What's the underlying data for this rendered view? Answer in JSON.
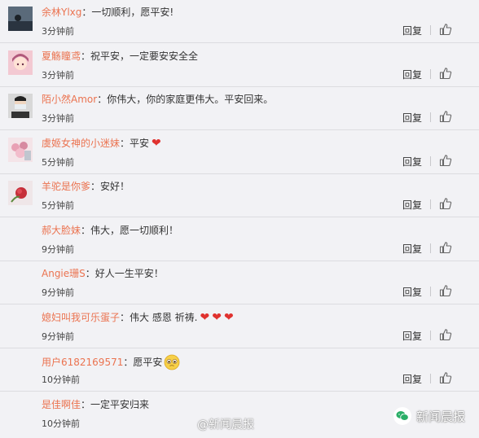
{
  "comments": [
    {
      "username": "余林Ylxg",
      "separator": "：",
      "text": "一切顺利，愿平安!",
      "time": "3分钟前",
      "reply": "回复",
      "avatar": "avatar-photo-dark"
    },
    {
      "username": "夏觞瞳鸢",
      "separator": "：",
      "text": "祝平安，一定要安安全全",
      "time": "3分钟前",
      "reply": "回复",
      "avatar": "avatar-anime-girl"
    },
    {
      "username": "陌小然Amor",
      "separator": "：",
      "text": "你伟大，你的家庭更伟大。平安回来。",
      "time": "3分钟前",
      "reply": "回复",
      "avatar": "avatar-masked-face"
    },
    {
      "username": "虞姬女神的小迷妹",
      "separator": "：",
      "text": "平安",
      "time": "5分钟前",
      "reply": "回复",
      "avatar": "avatar-flowers",
      "hearts": "heart-emoji"
    },
    {
      "username": "羊驼是你爹",
      "separator": "：",
      "text": "安好！",
      "time": "5分钟前",
      "reply": "回复",
      "avatar": "avatar-red-flower"
    },
    {
      "username": "郝大脸妹",
      "separator": "：",
      "text": "伟大，愿一切顺利！",
      "time": "9分钟前",
      "reply": "回复"
    },
    {
      "username": "Angie珊S",
      "separator": "：",
      "text": "好人一生平安！",
      "time": "9分钟前",
      "reply": "回复"
    },
    {
      "username": "媳妇叫我可乐蛋子",
      "separator": "：",
      "text": "伟大 感恩 祈祷.",
      "time": "9分钟前",
      "reply": "回复",
      "hearts": "heart-emoji-x3"
    },
    {
      "username": "用户6182169571",
      "separator": "：",
      "text": "愿平安",
      "time": "10分钟前",
      "reply": "回复",
      "emoji": "pleading-face-emoji"
    },
    {
      "username": "是佳啊佳",
      "separator": "：",
      "text": "一定平安归来",
      "time": "10分钟前",
      "reply": "回复"
    }
  ],
  "watermark": "@新闻晨报",
  "brand": {
    "name": "新闻晨报",
    "icon": "wechat-icon"
  },
  "colors": {
    "username": "#eb7350",
    "heart": "#e0322f",
    "background": "#f2f2f5"
  }
}
